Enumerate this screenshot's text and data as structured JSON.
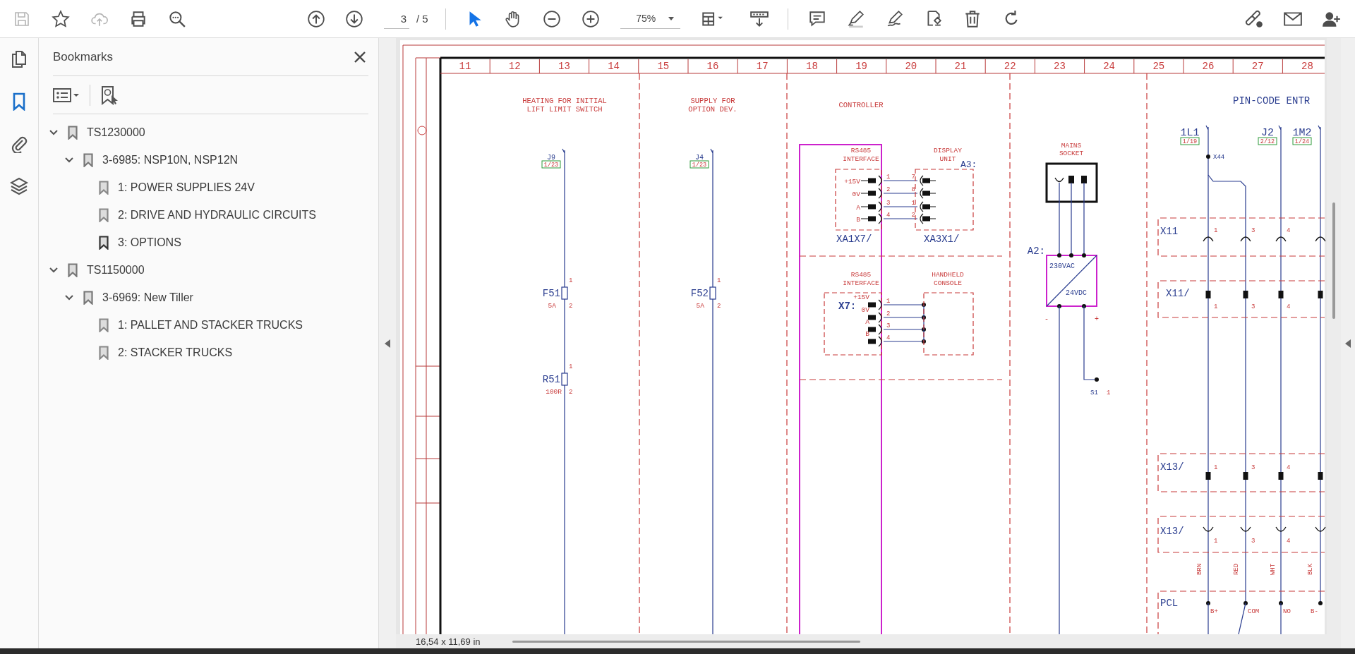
{
  "toolbar": {
    "file_tools": [
      {
        "disabled": true
      },
      {
        "disabled": false
      },
      {
        "disabled": true
      },
      {
        "disabled": false
      },
      {
        "disabled": false
      }
    ],
    "page_field": {
      "value": "3"
    },
    "page_total": "/ 5",
    "mode_tools": [
      {
        "selected": true
      },
      {
        "selected": false
      }
    ],
    "zoom": {
      "value": "75%"
    }
  },
  "rail": [
    {
      "selected": false
    },
    {
      "selected": true
    },
    {
      "selected": false
    },
    {
      "selected": false
    }
  ],
  "bookmarks_panel": {
    "title": "Bookmarks",
    "items": [
      {
        "label": "TS1230000",
        "expanded": true,
        "children": [
          {
            "label": "3-6985: NSP10N, NSP12N",
            "expanded": true,
            "children": [
              {
                "label": "1: POWER SUPPLIES 24V",
                "current": false
              },
              {
                "label": "2: DRIVE AND HYDRAULIC CIRCUITS",
                "current": false
              },
              {
                "label": "3: OPTIONS",
                "current": true
              }
            ]
          }
        ]
      },
      {
        "label": "TS1150000",
        "expanded": true,
        "children": [
          {
            "label": "3-6969: New Tiller",
            "expanded": true,
            "children": [
              {
                "label": "1: PALLET AND STACKER TRUCKS",
                "current": false
              },
              {
                "label": "2: STACKER TRUCKS",
                "current": false
              }
            ]
          }
        ]
      }
    ]
  },
  "document": {
    "columns": [
      "11",
      "12",
      "13",
      "14",
      "15",
      "16",
      "17",
      "18",
      "19",
      "20",
      "21",
      "22",
      "23",
      "24",
      "25",
      "26",
      "27",
      "28"
    ],
    "section_titles": [
      {
        "lines": [
          "HEATING FOR INITIAL",
          "LIFT LIMIT SWITCH"
        ]
      },
      {
        "lines": [
          "SUPPLY FOR",
          "OPTION DEV."
        ]
      },
      {
        "lines": [
          "CONTROLLER"
        ]
      },
      {
        "lines": [
          "PIN-CODE ENTR"
        ]
      }
    ],
    "feeds": [
      {
        "name": "J9",
        "ref": "1/23"
      },
      {
        "name": "J4",
        "ref": "1/23"
      },
      {
        "name": "1L1",
        "ref": "1/19"
      },
      {
        "name": "J2",
        "ref": "2/12"
      },
      {
        "name": "1M2",
        "ref": "1/24"
      }
    ],
    "fuses": [
      {
        "name": "F51",
        "rating": "5A",
        "pin_in": "1",
        "pin_out": "2"
      },
      {
        "name": "F52",
        "rating": "5A",
        "pin_in": "1",
        "pin_out": "2"
      }
    ],
    "resistor": {
      "name": "R51",
      "value": "100R",
      "pin_in": "1",
      "pin_out": "2"
    },
    "controller_ports": [
      {
        "title": [
          "RS485",
          "INTERFACE"
        ],
        "connector": "XA1X7/",
        "pins": [
          {
            "label": "+15V",
            "wire": "1",
            "mate": "7"
          },
          {
            "label": "0V",
            "wire": "2",
            "mate": "8"
          },
          {
            "label": "A",
            "wire": "3",
            "mate": "1"
          },
          {
            "label": "B",
            "wire": "4",
            "mate": "2"
          }
        ],
        "device": {
          "title": [
            "DISPLAY",
            "UNIT"
          ],
          "tag": "A3:",
          "connector": "XA3X1/"
        }
      },
      {
        "title": [
          "RS485",
          "INTERFACE"
        ],
        "connector": "X7:",
        "pins": [
          {
            "label": "+15V",
            "wire": "1"
          },
          {
            "label": "0V",
            "wire": "2"
          },
          {
            "label": "A",
            "wire": "3"
          },
          {
            "label": "B",
            "wire": "4"
          }
        ],
        "device": {
          "title": [
            "HANDHELD",
            "CONSOLE"
          ]
        }
      }
    ],
    "mains": {
      "title": [
        "MAINS",
        "SOCKET"
      ],
      "tag": "A2:",
      "input": "230VAC",
      "output": "24VDC",
      "minus": "-",
      "plus": "+",
      "switch": "S1",
      "switch_pin": "1"
    },
    "pin_code": {
      "splice": "X44",
      "connectors": [
        {
          "name": "X11",
          "kind": "socket",
          "pins": [
            "1",
            "3",
            "4"
          ]
        },
        {
          "name": "X11/",
          "kind": "plug",
          "pins": [
            "1",
            "3",
            "4"
          ]
        },
        {
          "name": "X13/",
          "kind": "plug",
          "pins": [
            "1",
            "3",
            "4"
          ]
        },
        {
          "name": "X13/",
          "kind": "socket",
          "pins": [
            "1",
            "3",
            "4"
          ]
        }
      ],
      "wire_colors": [
        "BRN",
        "RED",
        "WHT",
        "BLK"
      ],
      "device": {
        "name": "PCL",
        "terminals": [
          "B+",
          "COM",
          "NO",
          "B-"
        ]
      }
    }
  },
  "status_bar": {
    "page_size": "16,54 x 11,69 in"
  }
}
